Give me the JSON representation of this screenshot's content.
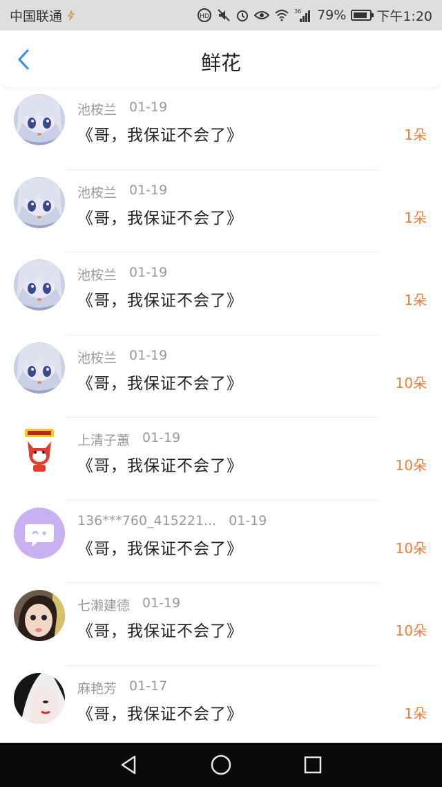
{
  "status_bar": {
    "carrier": "中国联通",
    "battery_percent": "79%",
    "time": "下午1:20",
    "network": "36",
    "icons": [
      "hd-icon",
      "mute-icon",
      "alarm-icon",
      "eye-icon",
      "wifi-icon",
      "signal-icon",
      "battery-icon"
    ]
  },
  "header": {
    "title": "鲜花",
    "back_icon": "chevron-left-icon"
  },
  "list": {
    "items": [
      {
        "user": "池桉兰",
        "date": "01-19",
        "title": "《哥，我保证不会了》",
        "amount": "1朵",
        "avatar": "anime-girl"
      },
      {
        "user": "池桉兰",
        "date": "01-19",
        "title": "《哥，我保证不会了》",
        "amount": "1朵",
        "avatar": "anime-girl"
      },
      {
        "user": "池桉兰",
        "date": "01-19",
        "title": "《哥，我保证不会了》",
        "amount": "1朵",
        "avatar": "anime-girl"
      },
      {
        "user": "池桉兰",
        "date": "01-19",
        "title": "《哥，我保证不会了》",
        "amount": "10朵",
        "avatar": "anime-girl"
      },
      {
        "user": "上清子蕙",
        "date": "01-19",
        "title": "《哥，我保证不会了》",
        "amount": "10朵",
        "avatar": "cartoon-fox"
      },
      {
        "user": "136***760_415221...",
        "date": "01-19",
        "title": "《哥，我保证不会了》",
        "amount": "10朵",
        "avatar": "chat-bubble"
      },
      {
        "user": "七濑建德",
        "date": "01-19",
        "title": "《哥，我保证不会了》",
        "amount": "10朵",
        "avatar": "photo-person"
      },
      {
        "user": "麻艳芳",
        "date": "01-17",
        "title": "《哥，我保证不会了》",
        "amount": "1朵",
        "avatar": "photo-bw"
      }
    ]
  },
  "nav_bar": {
    "icons": [
      "back-triangle-icon",
      "home-circle-icon",
      "recents-square-icon"
    ]
  },
  "colors": {
    "accent_blue": "#2f8ef5",
    "amount_orange": "#f07f3c",
    "status_bar_bg": "#dedede",
    "nav_bar_bg": "#0a0a0a"
  }
}
